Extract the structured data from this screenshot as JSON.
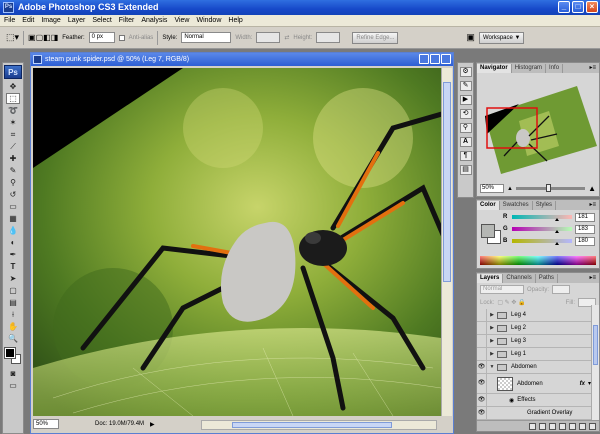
{
  "app": {
    "title": "Adobe Photoshop CS3 Extended",
    "logo": "Ps"
  },
  "menu": [
    "File",
    "Edit",
    "Image",
    "Layer",
    "Select",
    "Filter",
    "Analysis",
    "View",
    "Window",
    "Help"
  ],
  "options": {
    "feather_label": "Feather:",
    "feather_value": "0 px",
    "antialias_label": "Anti-alias",
    "style_label": "Style:",
    "style_value": "Normal",
    "width_label": "Width:",
    "height_label": "Height:",
    "refine_label": "Refine Edge...",
    "workspace_label": "Workspace ▼"
  },
  "document": {
    "title": "steam punk spider.psd @ 50% (Leg 7, RGB/8)",
    "zoom": "50%",
    "doc_info": "Doc: 19.0M/79.4M"
  },
  "navigator": {
    "tabs": [
      "Navigator",
      "Histogram",
      "Info"
    ],
    "zoom": "50%"
  },
  "color": {
    "tabs": [
      "Color",
      "Swatches",
      "Styles"
    ],
    "foreground": "#b5b7b4",
    "channels": [
      {
        "label": "R",
        "value": "181",
        "fraction": 0.71
      },
      {
        "label": "G",
        "value": "183",
        "fraction": 0.72
      },
      {
        "label": "B",
        "value": "180",
        "fraction": 0.71
      }
    ]
  },
  "layers": {
    "tabs": [
      "Layers",
      "Channels",
      "Paths"
    ],
    "blend_mode": "Normal",
    "opacity_label": "Opacity:",
    "lock_label": "Lock:",
    "fill_label": "Fill:",
    "items": [
      {
        "name": "Leg 4",
        "type": "group",
        "visible": false
      },
      {
        "name": "Leg 2",
        "type": "group",
        "visible": false
      },
      {
        "name": "Leg 3",
        "type": "group",
        "visible": false
      },
      {
        "name": "Leg 1",
        "type": "group",
        "visible": false
      },
      {
        "name": "Abdomen",
        "type": "group-open",
        "visible": true
      },
      {
        "name": "Abdomen",
        "type": "layer",
        "visible": true,
        "fx": "fx"
      },
      {
        "name": "Effects",
        "type": "effects",
        "visible": true
      },
      {
        "name": "Gradient Overlay",
        "type": "effect",
        "visible": true
      }
    ]
  }
}
